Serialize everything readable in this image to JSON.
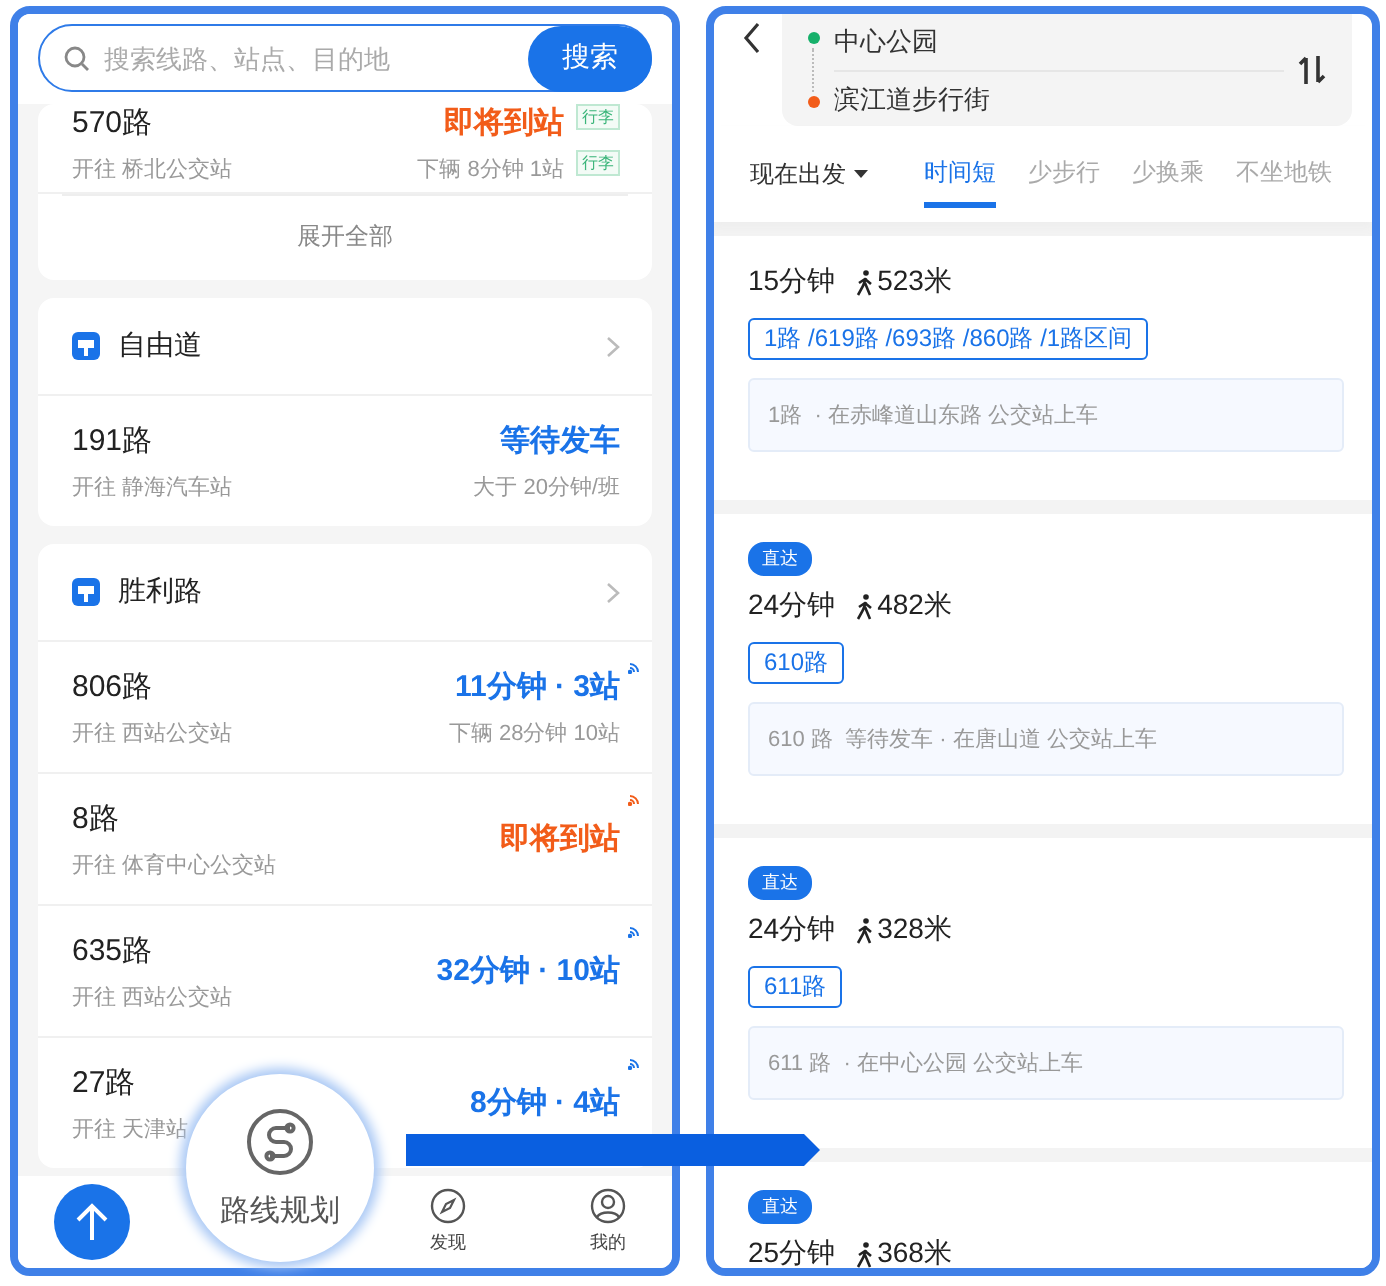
{
  "left": {
    "search": {
      "placeholder": "搜索线路、站点、目的地",
      "button": "搜索"
    },
    "top_card": {
      "rows": [
        {
          "route": "570路",
          "towards": "开往 桥北公交站",
          "status": "即将到站",
          "color": "#f25c19",
          "next": "下辆 8分钟 1站",
          "tags": [
            "行李",
            "行李"
          ],
          "realtime": false
        }
      ],
      "expand": "展开全部"
    },
    "stops": [
      {
        "name": "自由道",
        "rows": [
          {
            "route": "191路",
            "towards": "开往 静海汽车站",
            "status": "等待发车",
            "color": "#1a73e8",
            "next": "大于 20分钟/班",
            "realtime": false
          }
        ]
      },
      {
        "name": "胜利路",
        "rows": [
          {
            "route": "806路",
            "towards": "开往 西站公交站",
            "status": "11分钟 · 3站",
            "color": "#1a73e8",
            "next": "下辆 28分钟 10站",
            "realtime": true
          },
          {
            "route": "8路",
            "towards": "开往 体育中心公交站",
            "status": "即将到站",
            "color": "#f25c19",
            "realtime": true
          },
          {
            "route": "635路",
            "towards": "开往 西站公交站",
            "status": "32分钟 · 10站",
            "color": "#1a73e8",
            "realtime": true
          },
          {
            "route": "27路",
            "towards": "开往 天津站",
            "status": "8分钟 · 4站",
            "color": "#1a73e8",
            "realtime": true
          }
        ]
      }
    ],
    "route_planner": {
      "label": "路线规划"
    },
    "nav": [
      {
        "kind": "discover",
        "label": "发现"
      },
      {
        "kind": "me",
        "label": "我的"
      }
    ]
  },
  "right": {
    "from": "中心公园",
    "to": "滨江道步行街",
    "depart": "现在出发",
    "tabs": [
      {
        "label": "时间短",
        "selected": true
      },
      {
        "label": "少步行",
        "selected": false
      },
      {
        "label": "少换乘",
        "selected": false
      },
      {
        "label": "不坐地铁",
        "selected": false
      }
    ],
    "plans": [
      {
        "time": "15分钟",
        "walk": "523米",
        "routes": "1路 /619路 /693路 /860路 /1路区间",
        "info": "1路  · 在赤峰道山东路 公交站上车"
      },
      {
        "badge": "直达",
        "time": "24分钟",
        "walk": "482米",
        "routes": "610路",
        "info": "610 路  等待发车 · 在唐山道 公交站上车"
      },
      {
        "badge": "直达",
        "time": "24分钟",
        "walk": "328米",
        "routes": "611路",
        "info": "611 路  · 在中心公园 公交站上车"
      },
      {
        "badge": "直达",
        "time": "25分钟",
        "walk": "368米"
      }
    ]
  }
}
